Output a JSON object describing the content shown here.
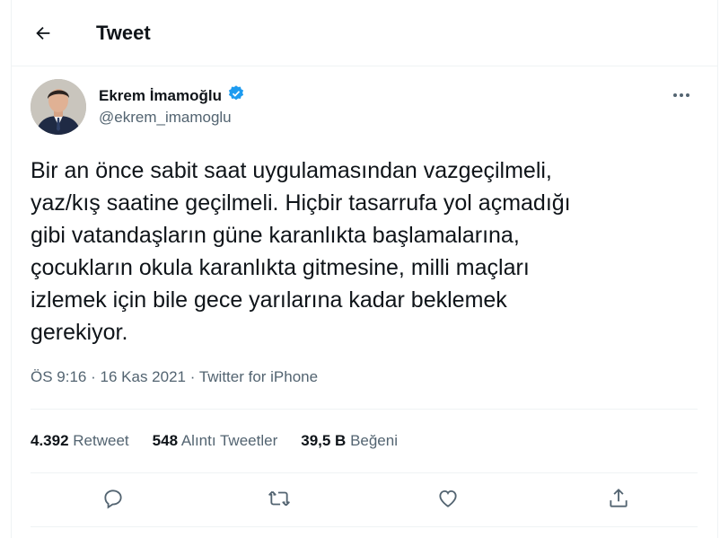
{
  "header": {
    "title": "Tweet"
  },
  "author": {
    "name": "Ekrem İmamoğlu",
    "handle": "@ekrem_imamoglu"
  },
  "tweet": {
    "text": "Bir an önce sabit saat uygulamasından vazgeçilmeli,\nyaz/kış saatine geçilmeli. Hiçbir tasarrufa yol açmadığı\ngibi vatandaşların güne karanlıkta başlamalarına,\nçocukların okula karanlıkta gitmesine, milli maçları\nizlemek için bile gece yarılarına kadar beklemek\ngerekiyor.",
    "time": "ÖS 9:16",
    "date": "16 Kas 2021",
    "source": "Twitter for iPhone",
    "separator": "·"
  },
  "stats": {
    "retweets": {
      "count": "4.392",
      "label": "Retweet"
    },
    "quotes": {
      "count": "548",
      "label": "Alıntı Tweetler"
    },
    "likes": {
      "count": "39,5 B",
      "label": "Beğeni"
    }
  },
  "icons": [
    "back-arrow-icon",
    "verified-badge-icon",
    "more-icon",
    "reply-icon",
    "retweet-icon",
    "like-icon",
    "share-icon"
  ],
  "colors": {
    "text": "#0f1419",
    "secondary": "#536471",
    "verified": "#1d9bf0",
    "border": "#eff3f4"
  }
}
